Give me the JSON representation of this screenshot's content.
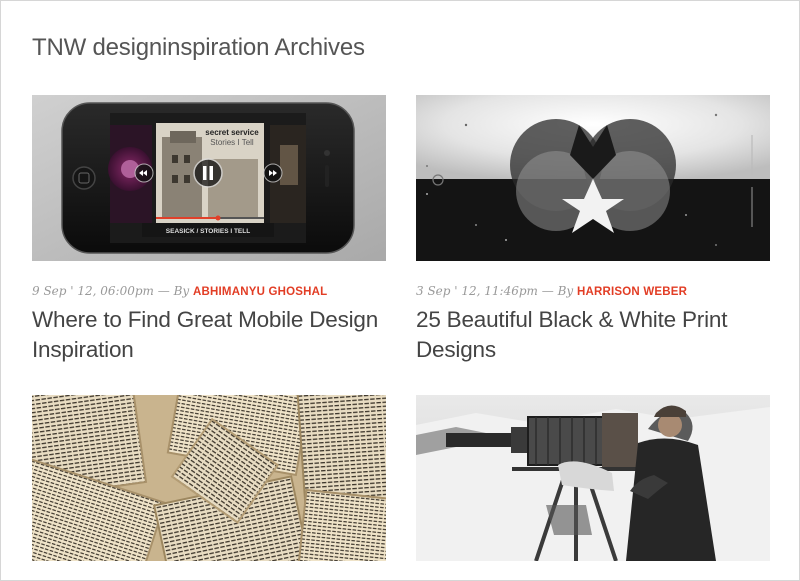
{
  "page": {
    "title": "TNW designinspiration Archives"
  },
  "posts": [
    {
      "date": "9 Sep ' 12, 06:00pm",
      "by": "— By",
      "author": "ABHIMANYU GHOSHAL",
      "title": "Where to Find Great Mobile Design Inspiration",
      "image": "iphone-music-app-image",
      "album_line1": "secret service",
      "album_line2": "Stories I Tell",
      "track": "SEASICK / STORIES I TELL"
    },
    {
      "date": "3 Sep ' 12, 11:46pm",
      "by": "— By",
      "author": "HARRISON WEBER",
      "title": "25 Beautiful Black & White Print Designs",
      "image": "black-white-print-image"
    },
    {
      "image": "old-book-pages-image"
    },
    {
      "image": "vintage-camera-photographer-image"
    }
  ],
  "colors": {
    "accent": "#e23d25",
    "title": "#444444",
    "meta": "#999999"
  }
}
